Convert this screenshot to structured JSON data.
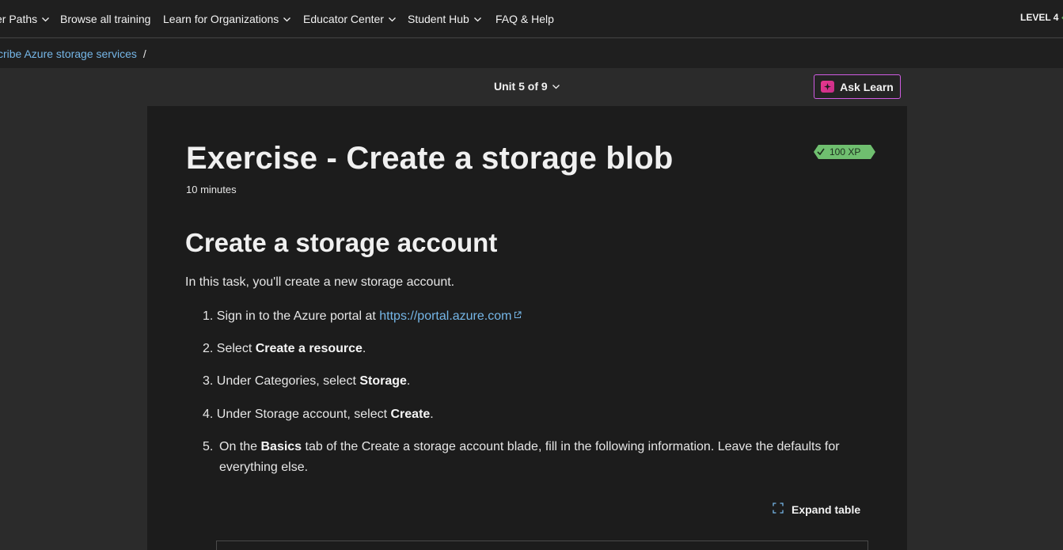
{
  "nav": {
    "items": [
      {
        "label": "er Paths",
        "has_dropdown": true
      },
      {
        "label": "Browse all training",
        "has_dropdown": false
      },
      {
        "label": "Learn for Organizations",
        "has_dropdown": true
      },
      {
        "label": "Educator Center",
        "has_dropdown": true
      },
      {
        "label": "Student Hub",
        "has_dropdown": true
      },
      {
        "label": "FAQ & Help",
        "has_dropdown": false
      }
    ],
    "level": "LEVEL 4"
  },
  "breadcrumb": {
    "link": "cribe Azure storage services",
    "separator": "/"
  },
  "unit_selector": "Unit 5 of 9",
  "ask_learn": "Ask Learn",
  "content": {
    "title": "Exercise - Create a storage blob",
    "xp": "100 XP",
    "duration": "10 minutes",
    "section_heading": "Create a storage account",
    "intro": "In this task, you'll create a new storage account.",
    "steps": [
      {
        "num": "1.",
        "pre": "Sign in to the Azure portal at ",
        "link": "https://portal.azure.com"
      },
      {
        "num": "2.",
        "pre": "Select ",
        "bold": "Create a resource",
        "post": "."
      },
      {
        "num": "3.",
        "pre": "Under Categories, select ",
        "bold": "Storage",
        "post": "."
      },
      {
        "num": "4.",
        "pre": "Under Storage account, select ",
        "bold": "Create",
        "post": "."
      },
      {
        "num": "5.",
        "pre": "On the ",
        "bold": "Basics",
        "post": " tab of the Create a storage account blade, fill in the following information. Leave the defaults for everything else."
      }
    ],
    "expand_table": "Expand table"
  },
  "colors": {
    "page_bg": "#2b2b2b",
    "panel_bg": "#1c1c1c",
    "link": "#75b6e7",
    "xp_badge": "#6fbf6f",
    "ask_border": "#d05ce3"
  }
}
